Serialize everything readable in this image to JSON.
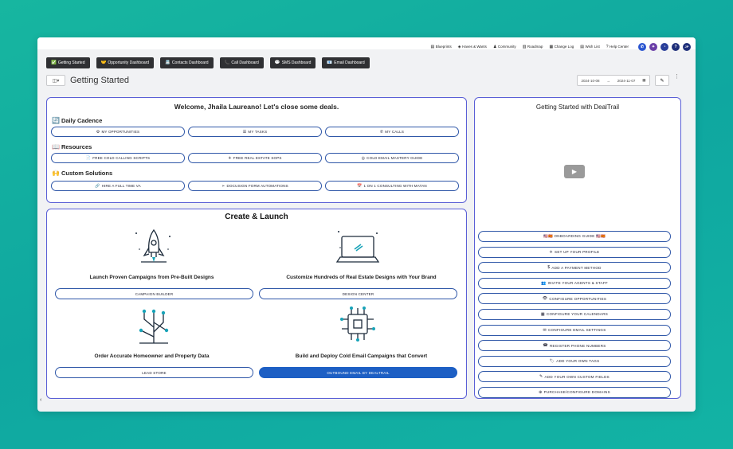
{
  "topbar": {
    "links": [
      {
        "icon": "▤",
        "label": "Blueprints"
      },
      {
        "icon": "◈",
        "label": "Haves & Wants"
      },
      {
        "icon": "♟",
        "label": "Community"
      },
      {
        "icon": "▥",
        "label": "Roadmap"
      },
      {
        "icon": "▦",
        "label": "Change Log"
      },
      {
        "icon": "▤",
        "label": "Wish List"
      },
      {
        "icon": "?",
        "label": "Help Center"
      }
    ],
    "avatar_initials": "JP",
    "help_symbol": "?"
  },
  "tabs": [
    {
      "icon": "✅",
      "label": "Getting Started"
    },
    {
      "icon": "🤝",
      "label": "Opportunity Dashboard"
    },
    {
      "icon": "📇",
      "label": "Contacts Dashboard"
    },
    {
      "icon": "📞",
      "label": "Call Dashboard"
    },
    {
      "icon": "💬",
      "label": "SMS Dashboard"
    },
    {
      "icon": "📧",
      "label": "Email Dashboard"
    }
  ],
  "page": {
    "title": "Getting Started",
    "date_from": "2024-10-08",
    "date_arrow": "→",
    "date_to": "2024-11-07"
  },
  "welcome": {
    "title": "Welcome, Jhaila Laureano! Let's close some deals.",
    "sections": [
      {
        "icon": "🔄",
        "title": "Daily Cadence",
        "buttons": [
          {
            "icon": "⚙",
            "label": "MY OPPORTUNITIES"
          },
          {
            "icon": "☰",
            "label": "MY TASKS"
          },
          {
            "icon": "✆",
            "label": "MY CALLS"
          }
        ]
      },
      {
        "icon": "📖",
        "title": "Resources",
        "buttons": [
          {
            "icon": "📄",
            "label": "FREE COLD CALLING SCRIPTS"
          },
          {
            "icon": "✈",
            "label": "FREE REAL ESTATE SOPS"
          },
          {
            "icon": "◎",
            "label": "COLD EMAIL MASTERY GUIDE"
          }
        ]
      },
      {
        "icon": "🙌",
        "title": "Custom Solutions",
        "buttons": [
          {
            "icon": "🔗",
            "label": "HIRE A FULL TIME VA"
          },
          {
            "icon": "➢",
            "label": "DOCUSIGN FORM AUTOMATIONS"
          },
          {
            "icon": "📅",
            "label": "1 ON 1 CONSULTING WITH MATAN"
          }
        ]
      }
    ]
  },
  "create": {
    "title": "Create & Launch",
    "features": [
      {
        "title": "Launch Proven Campaigns from Pre-Built Designs",
        "button": "CAMPAIGN BUILDER"
      },
      {
        "title": "Customize Hundreds of Real Estate Designs with Your Brand",
        "button": "DESIGN CENTER"
      },
      {
        "title": "Order Accurate Homeowner and Property Data",
        "button": "LEAD STORE"
      },
      {
        "title": "Build and Deploy Cold Email Campaigns that Convert",
        "button": "OUTBOUND EMAIL BY DEALTRAIL"
      }
    ]
  },
  "video_panel": {
    "title": "Getting Started with DealTrail",
    "play_symbol": "▶",
    "links": [
      {
        "icon": "",
        "label": "🇺🇸🇪🇸 ONBOARDING GUIDE 🇺🇸🇪🇸"
      },
      {
        "icon": "✈",
        "label": "SET UP YOUR PROFILE"
      },
      {
        "icon": "$",
        "label": "ADD A PAYMENT METHOD"
      },
      {
        "icon": "👥",
        "label": "INVITE YOUR AGENTS & STAFF"
      },
      {
        "icon": "👁",
        "label": "CONFIGURE OPPORTUNITIES"
      },
      {
        "icon": "▦",
        "label": "CONFIGURE YOUR CALENDARS"
      },
      {
        "icon": "✉",
        "label": "CONFIGURE EMAIL SETTINGS"
      },
      {
        "icon": "☎",
        "label": "REGISTER PHONE NUMBERS"
      },
      {
        "icon": "🏷",
        "label": "ADD YOUR OWN TAGS"
      },
      {
        "icon": "✎",
        "label": "ADD YOUR OWN CUSTOM FIELDS"
      },
      {
        "icon": "⊕",
        "label": "PURCHASE/CONFIGURE DOMAINS"
      }
    ]
  },
  "colors": {
    "background": "#13b0a2",
    "accent_border": "#5a5fd6",
    "pill_border": "#2f57a8",
    "primary_button": "#1d5fc4",
    "tab_bg": "#2f3033"
  }
}
